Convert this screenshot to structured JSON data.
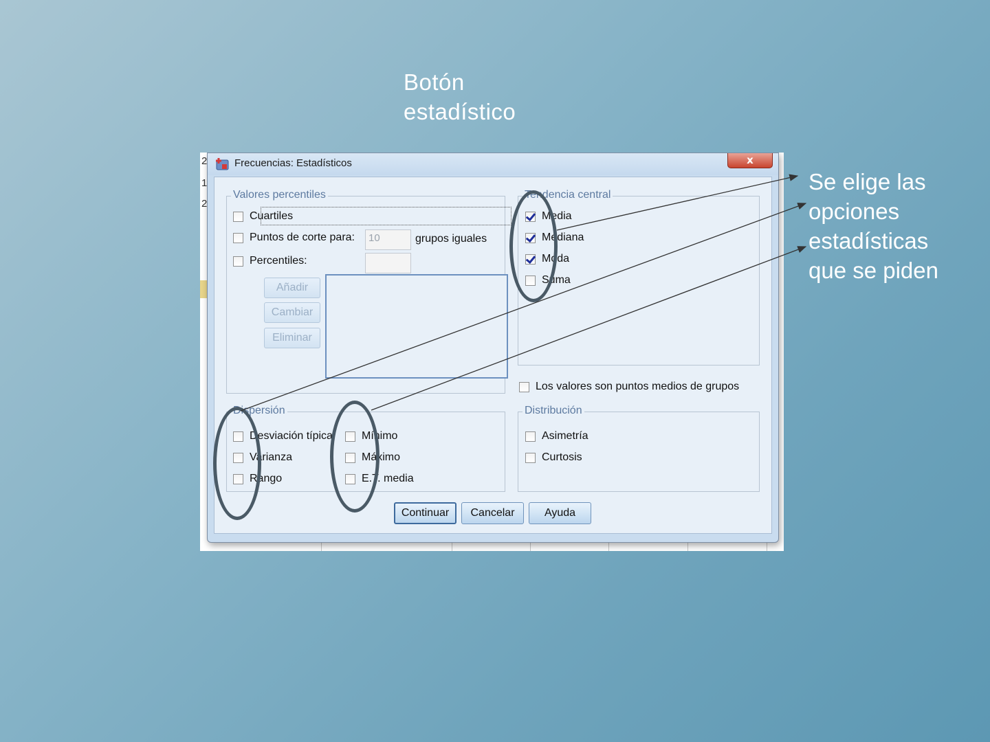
{
  "slide": {
    "title_line1": "Botón",
    "title_line2": "estadístico",
    "note_lines": [
      "Se elige las",
      "opciones",
      "estadísticas",
      "que se piden"
    ]
  },
  "background_sheet": {
    "row_labels": [
      "2",
      "1",
      "2"
    ]
  },
  "dialog": {
    "title": "Frecuencias: Estadísticos",
    "close_label": "x",
    "percentiles": {
      "legend": "Valores percentiles",
      "cuartiles": "Cuartiles",
      "puntos_corte": "Puntos de corte para:",
      "puntos_value": "10",
      "grupos_iguales": "grupos iguales",
      "percentiles": "Percentiles:",
      "add": "Añadir",
      "change": "Cambiar",
      "remove": "Eliminar"
    },
    "tendencia": {
      "legend": "Tendencia central",
      "media": "Media",
      "mediana": "Mediana",
      "moda": "Moda",
      "suma": "Suma",
      "checked": {
        "media": true,
        "mediana": true,
        "moda": true,
        "suma": false
      }
    },
    "puntos_medios": "Los valores son puntos medios de grupos",
    "dispersion": {
      "legend": "Dispersión",
      "desviacion": "Desviación típica",
      "varianza": "Varianza",
      "rango": "Rango",
      "minimo": "Mínimo",
      "maximo": "Máximo",
      "et_media": "E.T. media"
    },
    "distribucion": {
      "legend": "Distribución",
      "asimetria": "Asimetría",
      "curtosis": "Curtosis"
    },
    "buttons": {
      "continuar": "Continuar",
      "cancelar": "Cancelar",
      "ayuda": "Ayuda"
    }
  },
  "colors": {
    "annotation": "#4a5a66",
    "check": "#1f2f9a",
    "legend": "#5d7aa0"
  }
}
